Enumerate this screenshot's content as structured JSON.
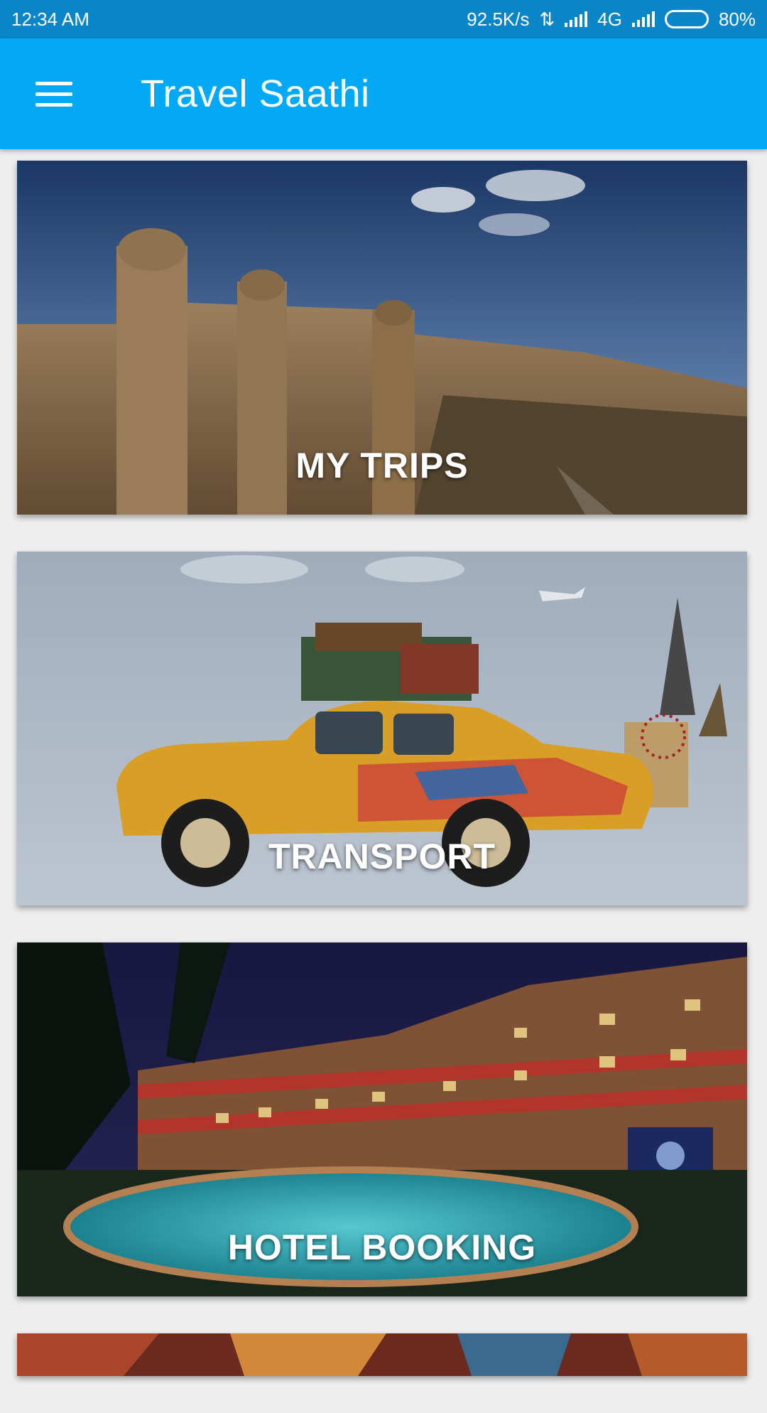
{
  "status_bar": {
    "time": "12:34 AM",
    "speed": "92.5K/s",
    "network": "4G",
    "battery": "80%",
    "battery_level": 0.8
  },
  "app_bar": {
    "menu_icon": "hamburger-menu-icon",
    "title": "Travel Saathi"
  },
  "cards": [
    {
      "label": "MY TRIPS",
      "image": "fort-landscape"
    },
    {
      "label": "TRANSPORT",
      "image": "yellow-car-with-luggage-and-landmarks"
    },
    {
      "label": "HOTEL BOOKING",
      "image": "resort-hotel-with-pool-at-night"
    },
    {
      "label": "",
      "image": "colorful-partial-card"
    }
  ],
  "colors": {
    "status_bar": "#0a86c8",
    "app_bar": "#03a9f4"
  }
}
